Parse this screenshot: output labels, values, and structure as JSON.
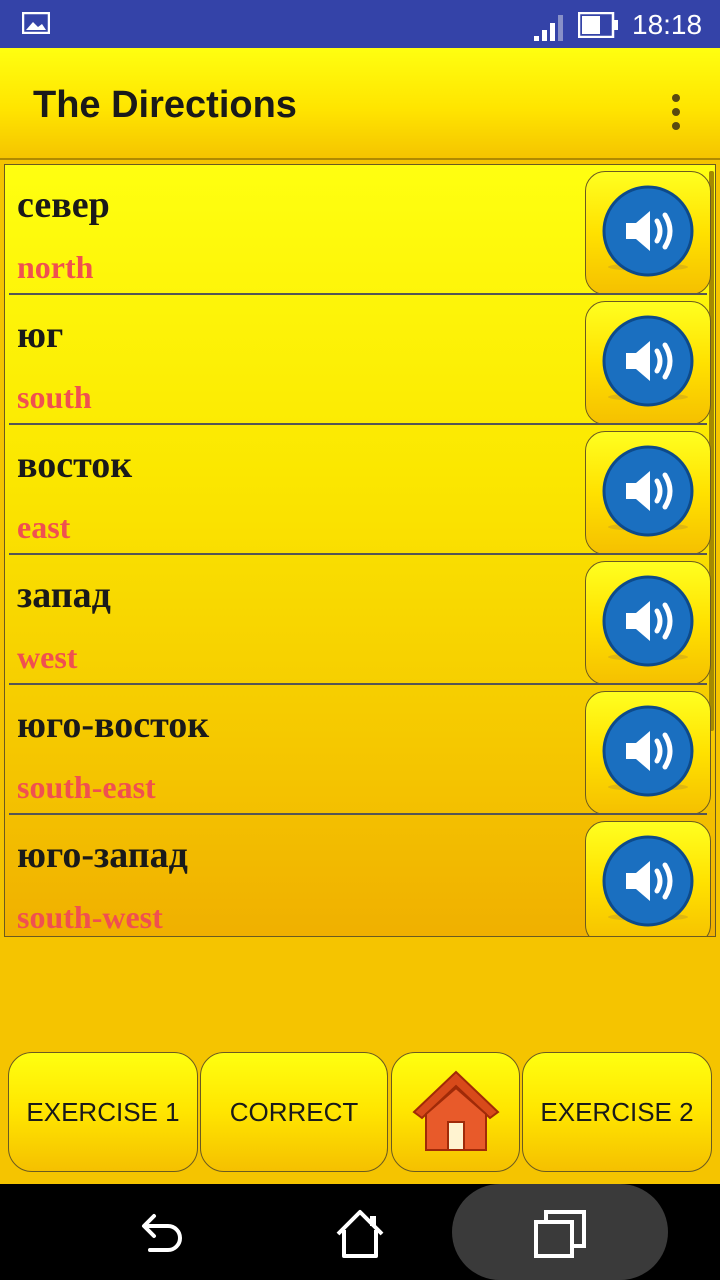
{
  "status_bar": {
    "time": "18:18",
    "icons": [
      "gallery-icon",
      "signal-icon",
      "battery-icon"
    ]
  },
  "app_bar": {
    "title": "The Directions",
    "menu_icon": "overflow-menu-icon"
  },
  "words": [
    {
      "word": "север",
      "translation": "north"
    },
    {
      "word": "юг",
      "translation": "south"
    },
    {
      "word": "восток",
      "translation": "east"
    },
    {
      "word": "запад",
      "translation": "west"
    },
    {
      "word": "юго-восток",
      "translation": "south-east"
    },
    {
      "word": "юго-запад",
      "translation": "south-west"
    }
  ],
  "bottom_bar": {
    "exercise1_label": "EXERCISE 1",
    "correct_label": "CORRECT",
    "home_icon": "house-icon",
    "exercise2_label": "EXERCISE 2"
  },
  "colors": {
    "status_bar": "#3443a8",
    "background": "#f5c400",
    "translation": "#f05050",
    "speaker_blue": "#1a6fc0"
  },
  "nav_bar": {
    "icons": [
      "back-icon",
      "home-icon",
      "recent-apps-icon"
    ]
  }
}
